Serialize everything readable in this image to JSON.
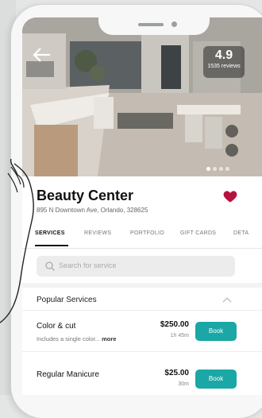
{
  "hero": {
    "rating": "4.9",
    "reviews": "1535 reviews",
    "back_icon": "arrow-left-icon"
  },
  "business": {
    "name": "Beauty Center",
    "address": "895 N Downtown Ave, Orlando, 328625"
  },
  "tabs": [
    "SERVICES",
    "REVIEWS",
    "PORTFOLIO",
    "GIFT CARDS",
    "DETA"
  ],
  "search": {
    "placeholder": "Search for service"
  },
  "section": {
    "title": "Popular Services"
  },
  "services": [
    {
      "name": "Color & cut",
      "desc": "Includes a single color...",
      "more": "more",
      "price": "$250.00",
      "duration": "1h 45m",
      "button": "Book"
    },
    {
      "name": "Regular Manicure",
      "desc": "",
      "more": "",
      "price": "$25.00",
      "duration": "30m",
      "button": "Book"
    }
  ],
  "colors": {
    "accent": "#1aa7a5",
    "heart": "#b5123f"
  }
}
